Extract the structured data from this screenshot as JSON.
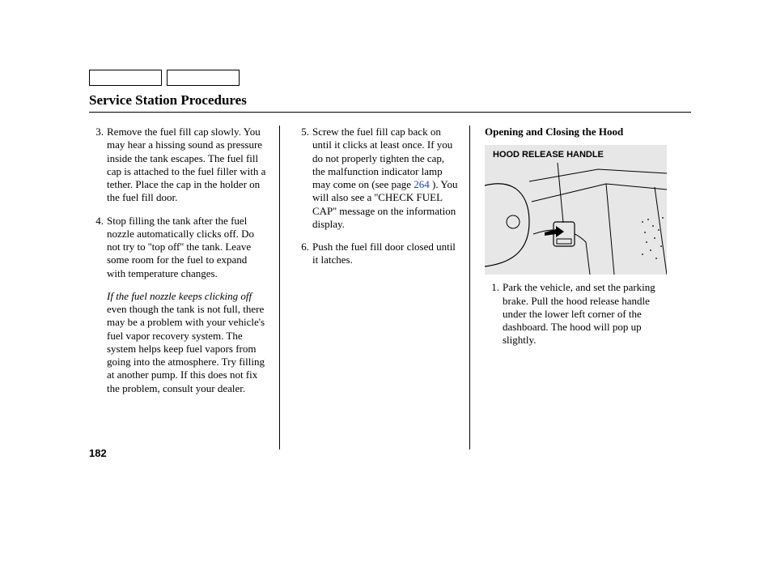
{
  "title": "Service Station Procedures",
  "page_number": "182",
  "col1": {
    "items": [
      {
        "n": "3.",
        "t": "Remove the fuel fill cap slowly. You may hear a hissing sound as pressure inside the tank escapes. The fuel fill cap is attached to the fuel filler with a tether. Place the cap in the holder on the fuel fill door."
      },
      {
        "n": "4.",
        "t": "Stop filling the tank after the fuel nozzle automatically clicks off. Do not try to ''top off'' the tank. Leave some room for the fuel to expand with temperature changes."
      }
    ],
    "note_italic": "If the fuel nozzle keeps clicking off",
    "note_body": " even though the tank is not full, there may be a problem with your vehicle's fuel vapor recovery system. The system helps keep fuel vapors from going into the atmosphere. Try filling at another pump. If this does not fix the problem, consult your dealer."
  },
  "col2": {
    "item5_n": "5.",
    "item5_pre": "Screw the fuel fill cap back on until it clicks at least once. If you do not properly tighten the cap, the malfunction indicator lamp may come on (see page ",
    "item5_link": "264",
    "item5_post": " ). You will also see a ''CHECK FUEL CAP'' message on the information display.",
    "item6_n": "6.",
    "item6_t": "Push the fuel fill door closed until it latches."
  },
  "col3": {
    "subtitle": "Opening and Closing the Hood",
    "figure_caption": "HOOD RELEASE HANDLE",
    "item1_n": "1.",
    "item1_t": "Park the vehicle, and set the parking brake. Pull the hood release handle under the lower left corner of the dashboard. The hood will pop up slightly."
  }
}
